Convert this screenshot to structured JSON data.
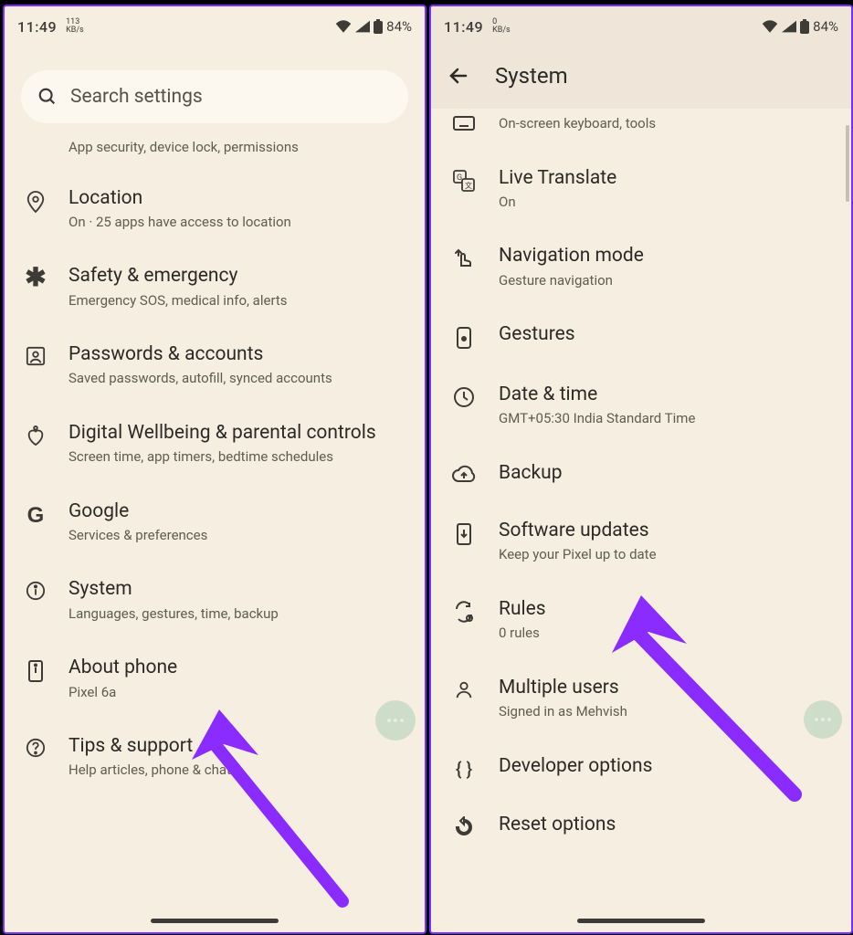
{
  "status": {
    "time": "11:49",
    "net_top": "113",
    "net_top_r": "0",
    "net_bot": "KB/s",
    "battery": "84%"
  },
  "left": {
    "search_placeholder": "Search settings",
    "partial_sub": "App security, device lock, permissions",
    "items": [
      {
        "icon": "location",
        "title": "Location",
        "sub": "On · 25 apps have access to location"
      },
      {
        "icon": "asterisk",
        "title": "Safety & emergency",
        "sub": "Emergency SOS, medical info, alerts"
      },
      {
        "icon": "person-box",
        "title": "Passwords & accounts",
        "sub": "Saved passwords, autofill, synced accounts"
      },
      {
        "icon": "heart",
        "title": "Digital Wellbeing & parental controls",
        "sub": "Screen time, app timers, bedtime schedules"
      },
      {
        "icon": "g",
        "title": "Google",
        "sub": "Services & preferences"
      },
      {
        "icon": "info",
        "title": "System",
        "sub": "Languages, gestures, time, backup"
      },
      {
        "icon": "phone-info",
        "title": "About phone",
        "sub": "Pixel 6a"
      },
      {
        "icon": "help",
        "title": "Tips & support",
        "sub": "Help articles, phone & chat"
      }
    ]
  },
  "right": {
    "header": "System",
    "partial_sub": "On-screen keyboard, tools",
    "items": [
      {
        "icon": "translate",
        "title": "Live Translate",
        "sub": "On"
      },
      {
        "icon": "nav",
        "title": "Navigation mode",
        "sub": "Gesture navigation"
      },
      {
        "icon": "gesture",
        "title": "Gestures",
        "sub": ""
      },
      {
        "icon": "clock",
        "title": "Date & time",
        "sub": "GMT+05:30 India Standard Time"
      },
      {
        "icon": "cloud",
        "title": "Backup",
        "sub": ""
      },
      {
        "icon": "update",
        "title": "Software updates",
        "sub": "Keep your Pixel up to date"
      },
      {
        "icon": "rules",
        "title": "Rules",
        "sub": "0 rules"
      },
      {
        "icon": "users",
        "title": "Multiple users",
        "sub": "Signed in as Mehvish"
      },
      {
        "icon": "braces",
        "title": "Developer options",
        "sub": ""
      },
      {
        "icon": "reset",
        "title": "Reset options",
        "sub": ""
      }
    ]
  }
}
